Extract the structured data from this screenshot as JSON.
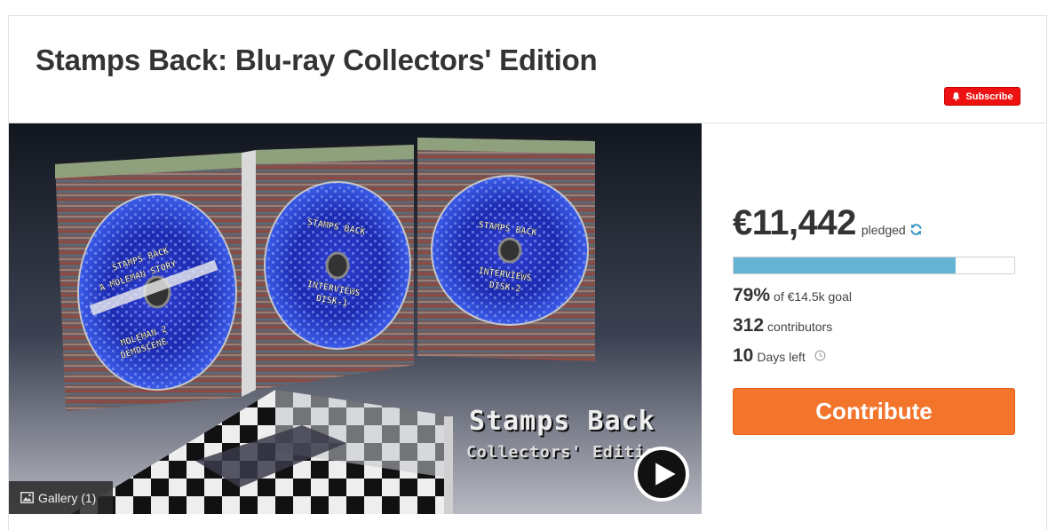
{
  "campaign": {
    "title": "Stamps Back: Blu-ray Collectors' Edition",
    "subscribe_label": "Subscribe"
  },
  "media": {
    "gallery_label": "Gallery (1)",
    "cover_title": "Stamps Back",
    "cover_subtitle": "Collectors' Edition",
    "disc_labels": [
      [
        "STAMPS BACK",
        "A MOLEMAN STORY",
        "MOLEMAN 2",
        "DEMOSCENE"
      ],
      [
        "STAMPS BACK",
        "INTERVIEWS",
        "DISK-1"
      ],
      [
        "STAMPS BACK",
        "INTERVIEWS",
        "DISK-2"
      ]
    ]
  },
  "funding": {
    "amount": "€11,442",
    "pledged_label": "pledged",
    "progress_fraction": 0.79,
    "percent": "79%",
    "goal_label": "of €14.5k goal",
    "contributors_count": "312",
    "contributors_label": "contributors",
    "days_count": "10",
    "days_label": "Days left",
    "contribute_label": "Contribute"
  },
  "colors": {
    "subscribe_bg": "#ee1111",
    "progress_fill": "#66b4d3",
    "contribute_bg": "#f3742b",
    "refresh_icon": "#2a8fc1"
  },
  "icons": {
    "subscribe": "bell-icon",
    "pledged": "refresh-icon",
    "days": "clock-icon",
    "gallery": "image-icon",
    "media": "play-icon"
  }
}
